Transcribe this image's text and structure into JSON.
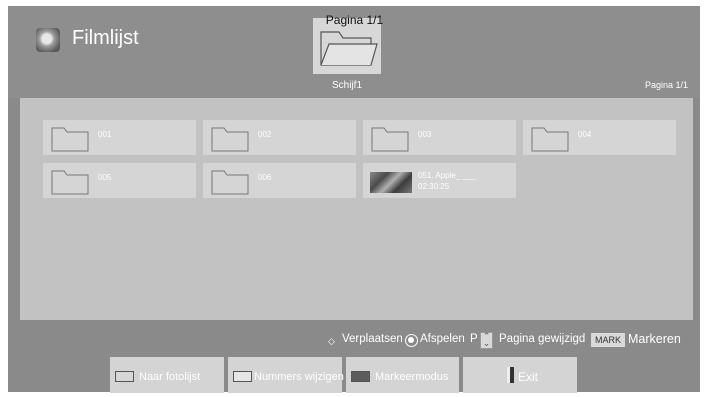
{
  "top_page_indicator": "Pagina 1/1",
  "header": {
    "title": "Filmlijst",
    "drive_label": "Schijf1",
    "page_indicator": "Pagina 1/1"
  },
  "tiles": [
    {
      "label": "001",
      "type": "folder"
    },
    {
      "label": "002",
      "type": "folder"
    },
    {
      "label": "003",
      "type": "folder"
    },
    {
      "label": "004",
      "type": "folder"
    },
    {
      "label": "005",
      "type": "folder"
    },
    {
      "label": "006",
      "type": "folder"
    },
    {
      "type": "video",
      "title": "051. Apple_ ___",
      "duration": "02:30:25"
    }
  ],
  "help": {
    "move": "Verplaatsen",
    "play": "Afspelen",
    "p_key": "P",
    "page_changed": "Pagina gewijzigd",
    "mark_key": "MARK",
    "mark": "Markeren"
  },
  "buttons": {
    "photo_list": "Naar fotolijst",
    "change_numbers": "Nummers wijzigen",
    "mark_mode": "Markeermodus",
    "exit": "Exit"
  },
  "colors": {
    "red_swatch": "#d6d6d6",
    "green_swatch": "#e6e6e6",
    "yellow_swatch": "#5c5c5c"
  }
}
